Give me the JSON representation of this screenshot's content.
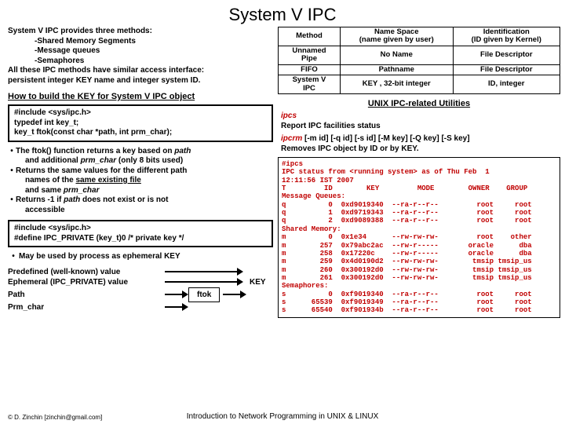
{
  "title": "System V IPC",
  "intro": {
    "line0": "System V IPC provides three methods:",
    "m1": "-Shared Memory Segments",
    "m2": "-Message queues",
    "m3": "-Semaphores",
    "line4": "All these IPC methods have similar access interface:",
    "line5": "persistent integer KEY name and integer system ID."
  },
  "build_key_heading": "How to build the KEY for System V IPC object",
  "code1": {
    "l1": "#include <sys/ipc.h>",
    "l2": "typedef int key_t;",
    "l3": "key_t ftok(const char *path, int prm_char);"
  },
  "bul": {
    "b1a": "The ftok() function returns a key based on ",
    "b1_path": "path",
    "b1b": "and additional ",
    "b1_prm": "prm_char",
    "b1c": " (only 8 bits used)",
    "b2a": "Returns the same values for the different path",
    "b2b": "names of the ",
    "b2_em": "same existing file",
    "b2c": "and same ",
    "b2_prm": "prm_char",
    "b3a": "Returns -1 if ",
    "b3_path": "path",
    "b3b": " does not exist or is not",
    "b3c": "accessible"
  },
  "code2": {
    "l1": "#include <sys/ipc.h>",
    "l2": "#define IPC_PRIVATE  (key_t)0   /* private key */"
  },
  "bul2": "May be used by process as ephemeral KEY",
  "pred": {
    "r1": "Predefined (well-known) value",
    "r2": "Ephemeral (IPC_PRIVATE) value",
    "r3": "Path",
    "r4": "Prm_char",
    "ftok": "ftok",
    "key": "KEY"
  },
  "table": {
    "h1": "Method",
    "h2a": "Name Space",
    "h2b": "(name given by user)",
    "h3a": "Identification",
    "h3b": "(ID given by Kernel)",
    "r1c1a": "Unnamed",
    "r1c1b": "Pipe",
    "r1c2": "No Name",
    "r1c3": "File Descriptor",
    "r2c1": "FIFO",
    "r2c2": "Pathname",
    "r2c3": "File Descriptor",
    "r3c1a": "System V",
    "r3c1b": "IPC",
    "r3c2": "KEY , 32-bit integer",
    "r3c3": "ID, integer"
  },
  "util_heading": "UNIX IPC-related Utilities",
  "ipcs": {
    "cmd": "ipcs",
    "desc": "Report IPC facilities status"
  },
  "ipcrm": {
    "cmd": "ipcrm",
    "opts": "  [-m id]  [-q id] [-s id] [-M key] [-Q key] [-S key]",
    "desc": "Removes IPC object by ID or by KEY."
  },
  "terminal": "#ipcs\nIPC status from <running system> as of Thu Feb  1\n12:11:56 IST 2007\nT         ID        KEY         MODE        OWNER    GROUP\nMessage Queues:\nq          0  0xd9019340  --ra-r--r--         root     root\nq          1  0xd9719343  --ra-r--r--         root     root\nq          2  0xd9089388  --ra-r--r--         root     root\nShared Memory:\nm          0  0x1e34      --rw-rw-rw-         root    other\nm        257  0x79abc2ac  --rw-r-----       oracle      dba\nm        258  0x17220c    --rw-r-----       oracle      dba\nm        259  0x4d0190d2  --rw-rw-rw-        tmsip tmsip_us\nm        260  0x300192d0  --rw-rw-rw-        tmsip tmsip_us\nm        261  0x300192d0  --rw-rw-rw-        tmsip tmsip_us\nSemaphores:\ns          0  0xf9019340  --ra-r--r--         root     root\ns      65539  0xf9019349  --ra-r--r--         root     root\ns      65540  0xf901934b  --ra-r--r--         root     root",
  "footer_left": "© D. Zinchin [zinchin@gmail.com]",
  "footer_center": "Introduction to Network Programming in UNIX & LINUX"
}
